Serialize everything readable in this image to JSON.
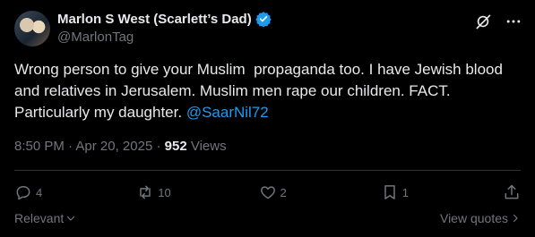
{
  "author": {
    "display_name": "Marlon S West (Scarlett’s Dad)",
    "handle": "@MarlonTag",
    "verified": true
  },
  "tweet": {
    "text_part": "Wrong person to give your Muslim  propaganda too. I have Jewish blood and relatives in Jerusalem. Muslim men rape our children. FACT. Particularly my daughter. ",
    "mention": "@SaarNil72"
  },
  "meta": {
    "time": "8:50 PM",
    "separator": " · ",
    "date": "Apr 20, 2025",
    "views_count": "952",
    "views_label": "Views"
  },
  "actions": {
    "replies": "4",
    "reposts": "10",
    "likes": "2",
    "bookmarks": "1"
  },
  "footer": {
    "relevant": "Relevant",
    "view_quotes": "View quotes"
  },
  "colors": {
    "background": "#000000",
    "text": "#e7e9ea",
    "muted": "#71767b",
    "accent": "#1d9bf0"
  }
}
